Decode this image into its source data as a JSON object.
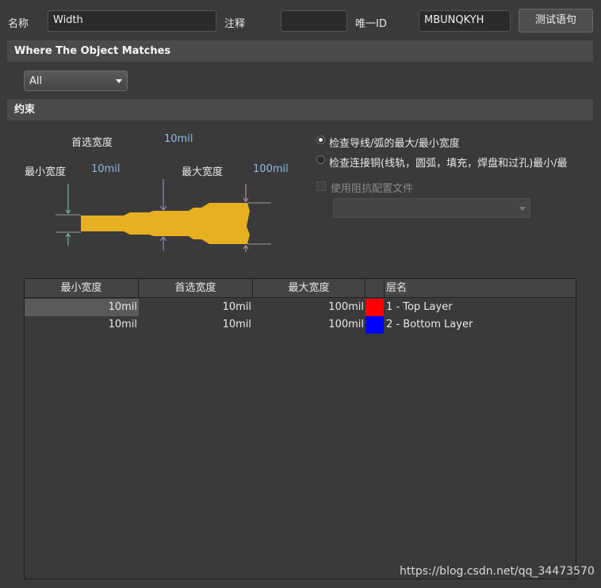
{
  "header": {
    "name_label": "名称",
    "name_value": "Width",
    "comment_label": "注释",
    "comment_value": "",
    "uid_label": "唯一ID",
    "uid_value": "MBUNQKYH",
    "test_button": "测试语句"
  },
  "where_section": {
    "title": "Where The Object Matches",
    "selected": "All"
  },
  "constraint_section": {
    "title": "约束",
    "preferred_label": "首选宽度",
    "preferred_value": "10mil",
    "min_label": "最小宽度",
    "min_value": "10mil",
    "max_label": "最大宽度",
    "max_value": "100mil",
    "option1": "检查导线/弧的最大/最小宽度",
    "option2": "检查连接铜(线轨，圆弧，填充，焊盘和过孔)最小/最",
    "option1_selected": true,
    "impedance_label": "使用阻抗配置文件",
    "impedance_checked": false,
    "trace_color": "#e6b020"
  },
  "layer_table": {
    "headers": [
      "最小宽度",
      "首选宽度",
      "最大宽度",
      "",
      "层名"
    ],
    "rows": [
      {
        "min": "10mil",
        "pref": "10mil",
        "max": "100mil",
        "color": "#ff0000",
        "layer": "1 - Top Layer"
      },
      {
        "min": "10mil",
        "pref": "10mil",
        "max": "100mil",
        "color": "#0000ff",
        "layer": "2 - Bottom Layer"
      }
    ]
  },
  "watermark": "https://blog.csdn.net/qq_34473570"
}
